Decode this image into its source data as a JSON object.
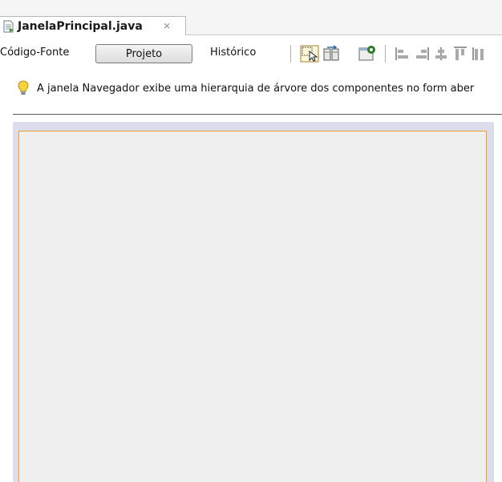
{
  "tab": {
    "title": "JanelaPrincipal.java",
    "close_glyph": "⨯",
    "icon": "java-file-icon"
  },
  "toolbar": {
    "source_label": "Código-Fonte",
    "design_label": "Projeto",
    "history_label": "Histórico",
    "icons": [
      "selection-mode-icon",
      "connection-mode-icon",
      "preview-design-icon",
      "align-left-icon",
      "align-right-icon",
      "center-horizontal-icon",
      "align-top-icon",
      "align-bottom-icon"
    ]
  },
  "hint": {
    "text": "A janela Navegador exibe uma hierarquia de árvore dos componentes no form aber",
    "icon": "lightbulb-icon"
  },
  "colors": {
    "form_border": "#f0a030",
    "canvas_background": "#dcdcec",
    "form_background": "#efefef"
  }
}
